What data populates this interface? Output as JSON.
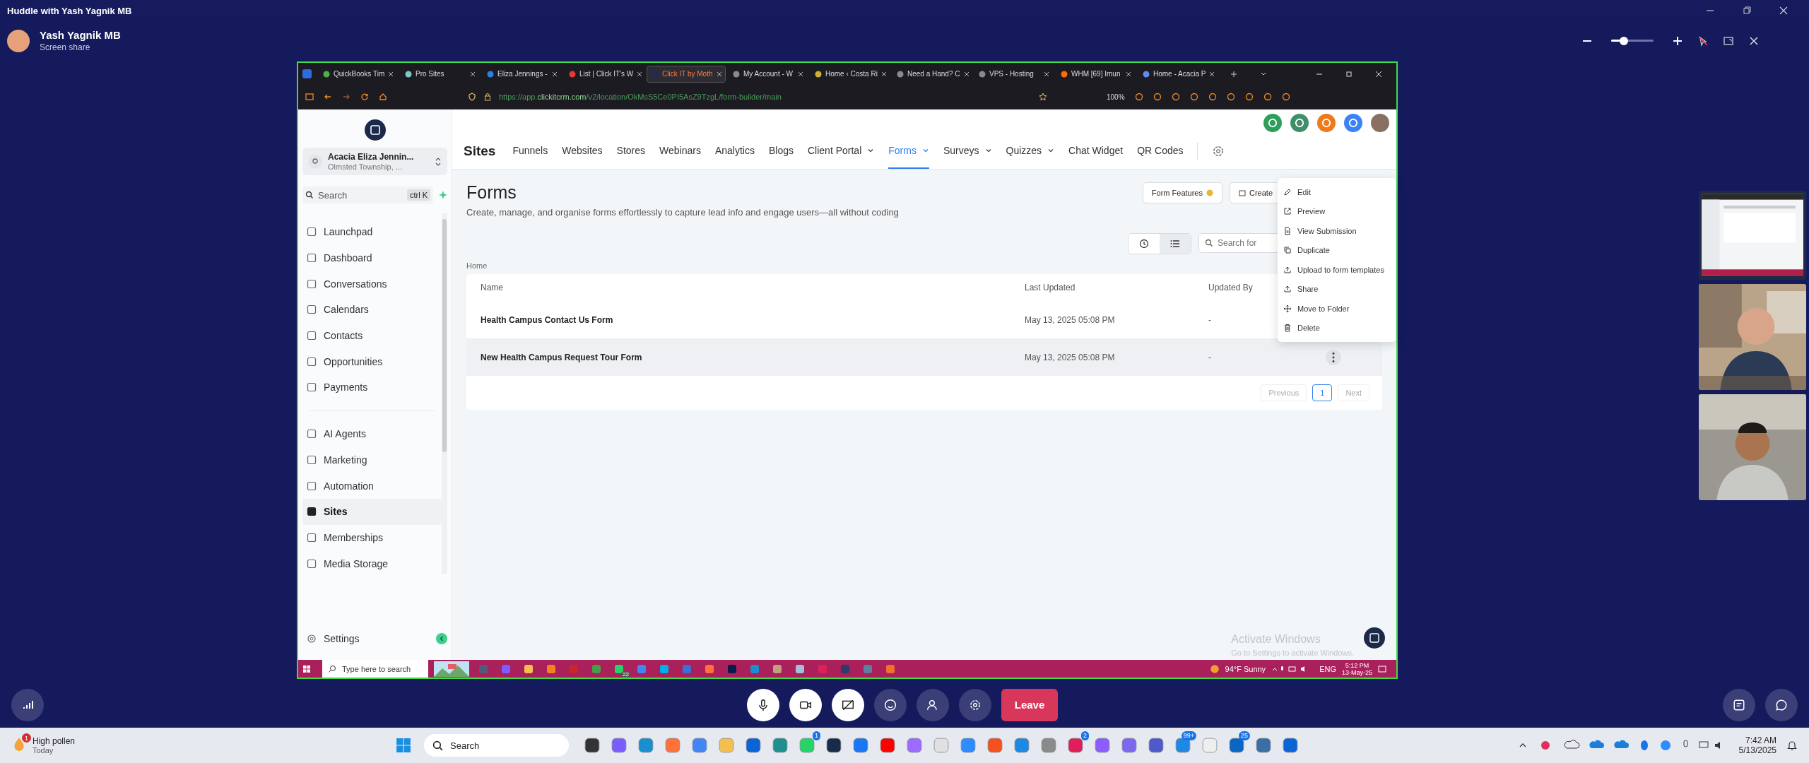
{
  "huddle": {
    "title": "Huddle with Yash Yagnik MB",
    "presenter": "Yash Yagnik MB",
    "subtitle": "Screen share",
    "zoom": {
      "level": 0.3
    }
  },
  "browser": {
    "tabs": [
      {
        "label": "QuickBooks Tim",
        "selected": false,
        "color": "#4caf50"
      },
      {
        "label": "Pro Sites",
        "selected": false,
        "color": "#7ec8c8"
      },
      {
        "label": "Eliza Jennings - ",
        "selected": false,
        "color": "#2f7de1"
      },
      {
        "label": "List | Click IT's W",
        "selected": false,
        "color": "#e53935"
      },
      {
        "label": "Click IT by Moth",
        "selected": true,
        "color": "#1e2a5a"
      },
      {
        "label": "My Account - W",
        "selected": false,
        "color": "#8a8a8a"
      },
      {
        "label": "Home ‹ Costa Ri",
        "selected": false,
        "color": "#c9b037"
      },
      {
        "label": "Need a Hand? C",
        "selected": false,
        "color": "#8a8a8a"
      },
      {
        "label": "VPS - Hosting",
        "selected": false,
        "color": "#8a8a8a"
      },
      {
        "label": "WHM [69] Imun",
        "selected": false,
        "color": "#ff6d00"
      },
      {
        "label": "Home - Acacia P",
        "selected": false,
        "color": "#5b8def"
      }
    ],
    "url_host": "https://app.",
    "url_domain": "clickitcrm.com",
    "url_path": "/v2/location/OkMsS5Ce0PI5AsZ9TzgL/form-builder/main",
    "zoom": "100%"
  },
  "sidebar": {
    "account_name": "Acacia Eliza Jennin...",
    "account_location": "Olmsted Township, ...",
    "search": "Search",
    "shortcut": "ctrl K",
    "groups": [
      [
        {
          "label": "Launchpad",
          "selected": false
        },
        {
          "label": "Dashboard",
          "selected": false
        },
        {
          "label": "Conversations",
          "selected": false
        },
        {
          "label": "Calendars",
          "selected": false
        },
        {
          "label": "Contacts",
          "selected": false
        },
        {
          "label": "Opportunities",
          "selected": false
        },
        {
          "label": "Payments",
          "selected": false
        }
      ],
      [
        {
          "label": "AI Agents",
          "selected": false
        },
        {
          "label": "Marketing",
          "selected": false
        },
        {
          "label": "Automation",
          "selected": false
        },
        {
          "label": "Sites",
          "selected": true
        },
        {
          "label": "Memberships",
          "selected": false
        },
        {
          "label": "Media Storage",
          "selected": false
        }
      ]
    ],
    "settings": "Settings"
  },
  "topnav": {
    "title": "Sites",
    "items": [
      {
        "label": "Funnels",
        "selected": false,
        "dropdown": false
      },
      {
        "label": "Websites",
        "selected": false,
        "dropdown": false
      },
      {
        "label": "Stores",
        "selected": false,
        "dropdown": false
      },
      {
        "label": "Webinars",
        "selected": false,
        "dropdown": false
      },
      {
        "label": "Analytics",
        "selected": false,
        "dropdown": false
      },
      {
        "label": "Blogs",
        "selected": false,
        "dropdown": false
      },
      {
        "label": "Client Portal",
        "selected": false,
        "dropdown": true
      },
      {
        "label": "Forms",
        "selected": true,
        "dropdown": true
      },
      {
        "label": "Surveys",
        "selected": false,
        "dropdown": true
      },
      {
        "label": "Quizzes",
        "selected": false,
        "dropdown": true
      },
      {
        "label": "Chat Widget",
        "selected": false,
        "dropdown": false
      },
      {
        "label": "QR Codes",
        "selected": false,
        "dropdown": false
      }
    ],
    "header_icons": [
      {
        "color": "#2e9e5b"
      },
      {
        "color": "#3f8f6a"
      },
      {
        "color": "#f07a1a"
      },
      {
        "color": "#3b82f6"
      }
    ]
  },
  "page": {
    "title": "Forms",
    "subtitle": "Create, manage, and organise forms effortlessly to capture lead info and engage users—all without coding",
    "features_button": "Form Features",
    "create_button": "Create",
    "views": [
      {
        "kind": "clock",
        "selected": false
      },
      {
        "kind": "list",
        "selected": true
      }
    ],
    "search_placeholder": "Search for",
    "breadcrumb": "Home",
    "table": {
      "columns": [
        "Name",
        "Last Updated",
        "Updated By"
      ],
      "rows": [
        {
          "name": "Health Campus Contact Us Form",
          "updated": "May 13, 2025 05:08 PM",
          "by": "-",
          "hovered": false
        },
        {
          "name": "New Health Campus Request Tour Form",
          "updated": "May 13, 2025 05:08 PM",
          "by": "-",
          "hovered": true
        }
      ]
    },
    "pagination": {
      "previous": "Previous",
      "pages": [
        {
          "label": "1",
          "selected": true
        }
      ],
      "next": "Next"
    },
    "menu": [
      {
        "kind": "edit",
        "label": "Edit"
      },
      {
        "kind": "external",
        "label": "Preview"
      },
      {
        "kind": "doc",
        "label": "View Submission"
      },
      {
        "kind": "copy",
        "label": "Duplicate"
      },
      {
        "kind": "upload",
        "label": "Upload to form templates"
      },
      {
        "kind": "upload",
        "label": "Share"
      },
      {
        "kind": "move",
        "label": "Move to Folder"
      },
      {
        "kind": "trash",
        "label": "Delete"
      }
    ],
    "activate_title": "Activate Windows",
    "activate_text": "Go to Settings to activate Windows."
  },
  "remote_taskbar": {
    "search": "Type here to search",
    "icons": [
      {
        "color": "#555a7a"
      },
      {
        "color": "#7b5cff"
      },
      {
        "color": "#f3c04d"
      },
      {
        "color": "#f58220"
      },
      {
        "color": "#c62828"
      },
      {
        "color": "#43a047"
      },
      {
        "color": "#25d366",
        "badge": "22"
      },
      {
        "color": "#4285f4"
      },
      {
        "color": "#00aff0"
      },
      {
        "color": "#3d6fd8"
      },
      {
        "color": "#ff7139"
      },
      {
        "color": "#0a1a4a"
      },
      {
        "color": "#1a8fd0"
      },
      {
        "color": "#c0a080"
      },
      {
        "color": "#a0c0e0"
      },
      {
        "color": "#e01e5a"
      },
      {
        "color": "#2f3b6b"
      },
      {
        "color": "#5f7fa0"
      },
      {
        "color": "#f07030"
      }
    ],
    "weather": "94°F  Sunny",
    "lang": "ENG",
    "time": "5:12 PM",
    "date": "13-May-25"
  },
  "controls": {
    "leave": "Leave"
  },
  "taskbar": {
    "weather": "High pollen",
    "weather_sub": "Today",
    "weather_badge": "1",
    "search": "Search",
    "icons": [
      {
        "color": "#333333"
      },
      {
        "color": "#7b5cff"
      },
      {
        "color": "#1a8fd0"
      },
      {
        "color": "#ff7139"
      },
      {
        "color": "#4285f4"
      },
      {
        "color": "#f3c04d"
      },
      {
        "color": "#0a64d6"
      },
      {
        "color": "#1d8f8f"
      },
      {
        "color": "#25d366",
        "badge": "1"
      },
      {
        "color": "#1a2a4a"
      },
      {
        "color": "#1877f2"
      },
      {
        "color": "#ff0000"
      },
      {
        "color": "#9b6cff"
      },
      {
        "color": "#e0e0e0"
      },
      {
        "color": "#2d8cff"
      },
      {
        "color": "#f4511e"
      },
      {
        "color": "#1e88e5"
      },
      {
        "color": "#8a8a8a"
      },
      {
        "color": "#e01e5a",
        "badge": "2"
      },
      {
        "color": "#8c5cff"
      },
      {
        "color": "#7b68ee"
      },
      {
        "color": "#5059c9"
      },
      {
        "color": "#1e88e5",
        "badge": "99+"
      },
      {
        "color": "#eeeeee"
      },
      {
        "color": "#0a66c2",
        "badge": "25"
      },
      {
        "color": "#3a6ea5"
      },
      {
        "color": "#0a64d6"
      }
    ],
    "time": "7:42 AM",
    "date": "5/13/2025"
  }
}
